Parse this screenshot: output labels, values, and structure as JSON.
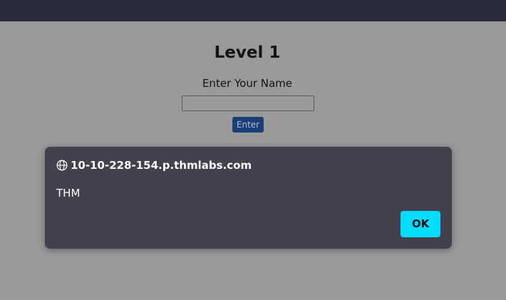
{
  "page": {
    "level_title": "Level 1",
    "name_label": "Enter Your Name",
    "name_input_value": "",
    "enter_button_label": "Enter"
  },
  "dialog": {
    "origin": "10-10-228-154.p.thmlabs.com",
    "message": "THM",
    "ok_label": "OK",
    "icon": "globe-icon"
  },
  "colors": {
    "topbar": "#272b3b",
    "page_overlay": "#9a9a9a",
    "dialog_bg": "#42414d",
    "ok_button": "#00ddff",
    "enter_button": "#1b3e79"
  }
}
